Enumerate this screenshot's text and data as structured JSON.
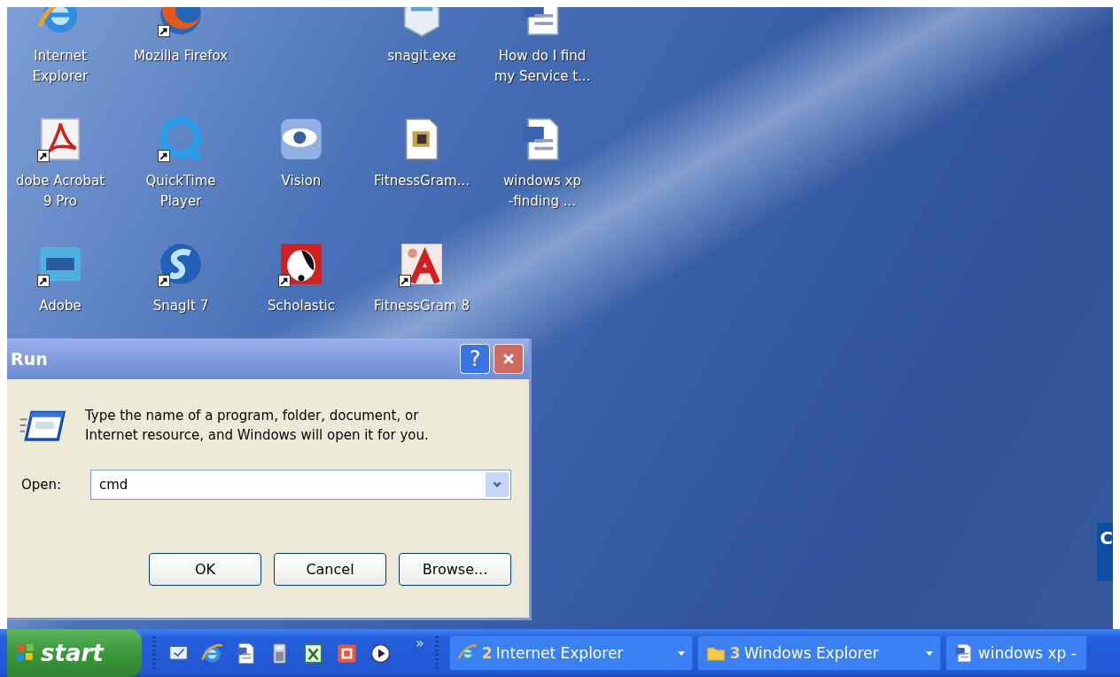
{
  "desktop_icons": [
    {
      "kind": "ie",
      "label": [
        "Internet",
        "Explorer"
      ],
      "shortcut": false
    },
    {
      "kind": "firefox",
      "label": [
        "Mozilla Firefox"
      ],
      "shortcut": true
    },
    {
      "kind": "box",
      "label": [
        "snagit.exe"
      ],
      "shortcut": false
    },
    {
      "kind": "word",
      "label": [
        "How do I find",
        "my Service t..."
      ],
      "shortcut": false
    },
    {
      "kind": "pdf",
      "label": [
        "dobe Acrobat",
        "9 Pro"
      ],
      "shortcut": true
    },
    {
      "kind": "quicktime",
      "label": [
        "QuickTime",
        "Player"
      ],
      "shortcut": true
    },
    {
      "kind": "eye",
      "label": [
        "Vision"
      ],
      "shortcut": false
    },
    {
      "kind": "doc",
      "label": [
        "FitnessGram..."
      ],
      "shortcut": false
    },
    {
      "kind": "word",
      "label": [
        "windows xp",
        "-finding ..."
      ],
      "shortcut": false
    },
    {
      "kind": "pse",
      "label": [
        "Adobe"
      ],
      "shortcut": true
    },
    {
      "kind": "snagit",
      "label": [
        "SnagIt 7"
      ],
      "shortcut": true
    },
    {
      "kind": "dog",
      "label": [
        "Scholastic"
      ],
      "shortcut": true
    },
    {
      "kind": "fitness",
      "label": [
        "FitnessGram 8"
      ],
      "shortcut": true
    }
  ],
  "edge_panel": {
    "text": "C"
  },
  "dialog": {
    "title": "Run",
    "help": "?",
    "message": "Type the name of a program, folder, document, or Internet resource, and Windows will open it for you.",
    "open_label": "Open:",
    "open_value": "cmd",
    "buttons": [
      "OK",
      "Cancel",
      "Browse..."
    ]
  },
  "taskbar": {
    "start": "start",
    "quick_launch": [
      {
        "kind": "desktop"
      },
      {
        "kind": "ie"
      },
      {
        "kind": "word"
      },
      {
        "kind": "calc"
      },
      {
        "kind": "excel"
      },
      {
        "kind": "ppt"
      },
      {
        "kind": "media"
      }
    ],
    "more": "»",
    "tasks": [
      {
        "kind": "ie",
        "count": "2",
        "label": "Internet Explorer",
        "group": true
      },
      {
        "kind": "folder",
        "count": "3",
        "label": "Windows Explorer",
        "group": true
      },
      {
        "kind": "word",
        "label": "windows xp -",
        "group": false
      }
    ]
  }
}
